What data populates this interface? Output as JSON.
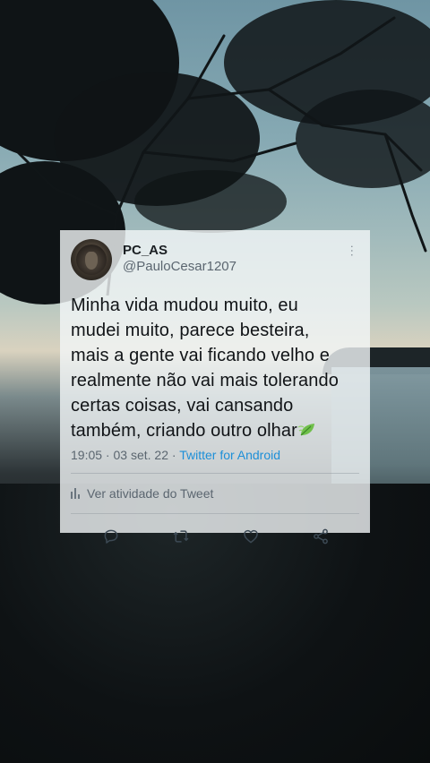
{
  "tweet": {
    "display_name": "PC_AS",
    "handle": "@PauloCesar1207",
    "text": "Minha vida mudou muito, eu\nmudei muito, parece besteira,\nmais a gente vai ficando velho e\nrealmente não vai mais tolerando\ncertas coisas, vai cansando\ntambém, criando outro olhar",
    "emoji_icon": "leaf-fluttering-icon",
    "time": "19:05",
    "separator": " · ",
    "date": "03 set. 22",
    "source": "Twitter for Android",
    "activity_label": "Ver atividade do Tweet",
    "more_icon": "more-dots-icon",
    "actions": {
      "reply_icon": "reply-icon",
      "retweet_icon": "retweet-icon",
      "like_icon": "heart-icon",
      "share_icon": "share-icon"
    }
  },
  "colors": {
    "card_background": "#f3f6f8",
    "link": "#1d8fd8",
    "text_primary": "#111417",
    "text_secondary": "#5b6670",
    "leaf_green": "#6fbf4a"
  }
}
